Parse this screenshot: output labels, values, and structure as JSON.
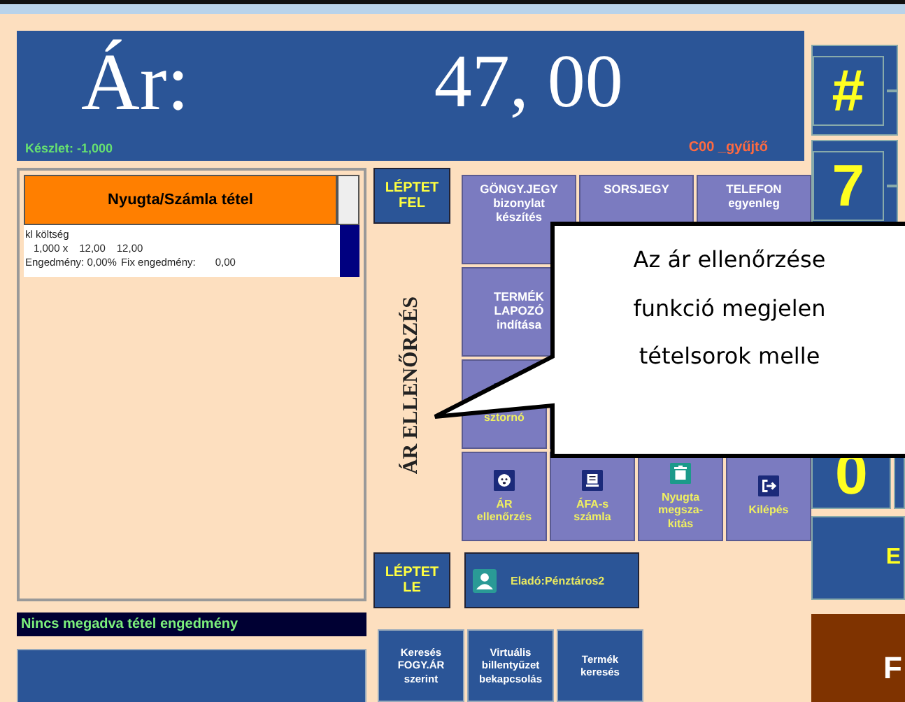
{
  "price_panel": {
    "label": "Ár:",
    "value": "47, 00",
    "stock": "Készlet: -1,000",
    "register": "C00 _gyűjtő"
  },
  "items_panel": {
    "header": "Nyugta/Számla tétel",
    "rows": [
      {
        "name": "kl költség",
        "qty": "1,000 x",
        "unit_price": "12,00",
        "total": "12,00",
        "discount": "Engedmény: 0,00%",
        "fixed_discount_label": "Fix engedmény:",
        "fixed_discount": "0,00"
      }
    ]
  },
  "status": "Nincs megadva tétel engedmény",
  "step_up": [
    "LÉPTET",
    "FEL"
  ],
  "vertical_label": "ÁR ELLENŐRZÉS",
  "step_down": [
    "LÉPTET",
    "LE"
  ],
  "function_rows": [
    [
      {
        "kind": "text",
        "lines": [
          "GÖNGY.JEGY",
          "bizonylat",
          "készítés"
        ]
      },
      {
        "kind": "text",
        "lines": [
          "SORSJEGY"
        ]
      },
      {
        "kind": "text",
        "lines": [
          "TELEFON",
          "egyenleg"
        ]
      }
    ],
    [
      {
        "kind": "text",
        "lines": [
          "TERMÉK",
          "LAPOZÓ",
          "indítása"
        ]
      },
      {
        "kind": "blank"
      },
      {
        "kind": "blank"
      }
    ],
    [
      {
        "kind": "cancel",
        "lines": [
          "sztornó"
        ]
      },
      {
        "kind": "blank"
      },
      {
        "kind": "blank"
      },
      {
        "kind": "blank"
      }
    ],
    [
      {
        "kind": "face",
        "lines": [
          "ÁR",
          "ellenőrzés"
        ]
      },
      {
        "kind": "invoice",
        "lines": [
          "ÁFA-s",
          "számla"
        ]
      },
      {
        "kind": "trash",
        "lines": [
          "Nyugta",
          "megsza-",
          "kitás"
        ]
      },
      {
        "kind": "exit",
        "lines": [
          "Kilépés"
        ]
      }
    ]
  ],
  "seller": "Eladó:Pénztáros2",
  "bottom_buttons": [
    [
      "Keresés",
      "FOGY.ÁR",
      "szerint"
    ],
    [
      "Virtuális",
      "billentyűzet",
      "bekapcsolás"
    ],
    [
      "Termék",
      "keresés"
    ]
  ],
  "keypad": [
    {
      "kind": "key",
      "label": "#"
    },
    {
      "kind": "key",
      "label": "7"
    },
    {
      "kind": "blank"
    },
    {
      "kind": "blank"
    },
    {
      "kind": "low",
      "label": "0"
    },
    {
      "kind": "wide",
      "label": "E"
    },
    {
      "kind": "brown",
      "label": "F"
    }
  ],
  "callout": [
    "Az ár ellenőrzése",
    "funkció megjelen",
    "tételsorok melle"
  ]
}
